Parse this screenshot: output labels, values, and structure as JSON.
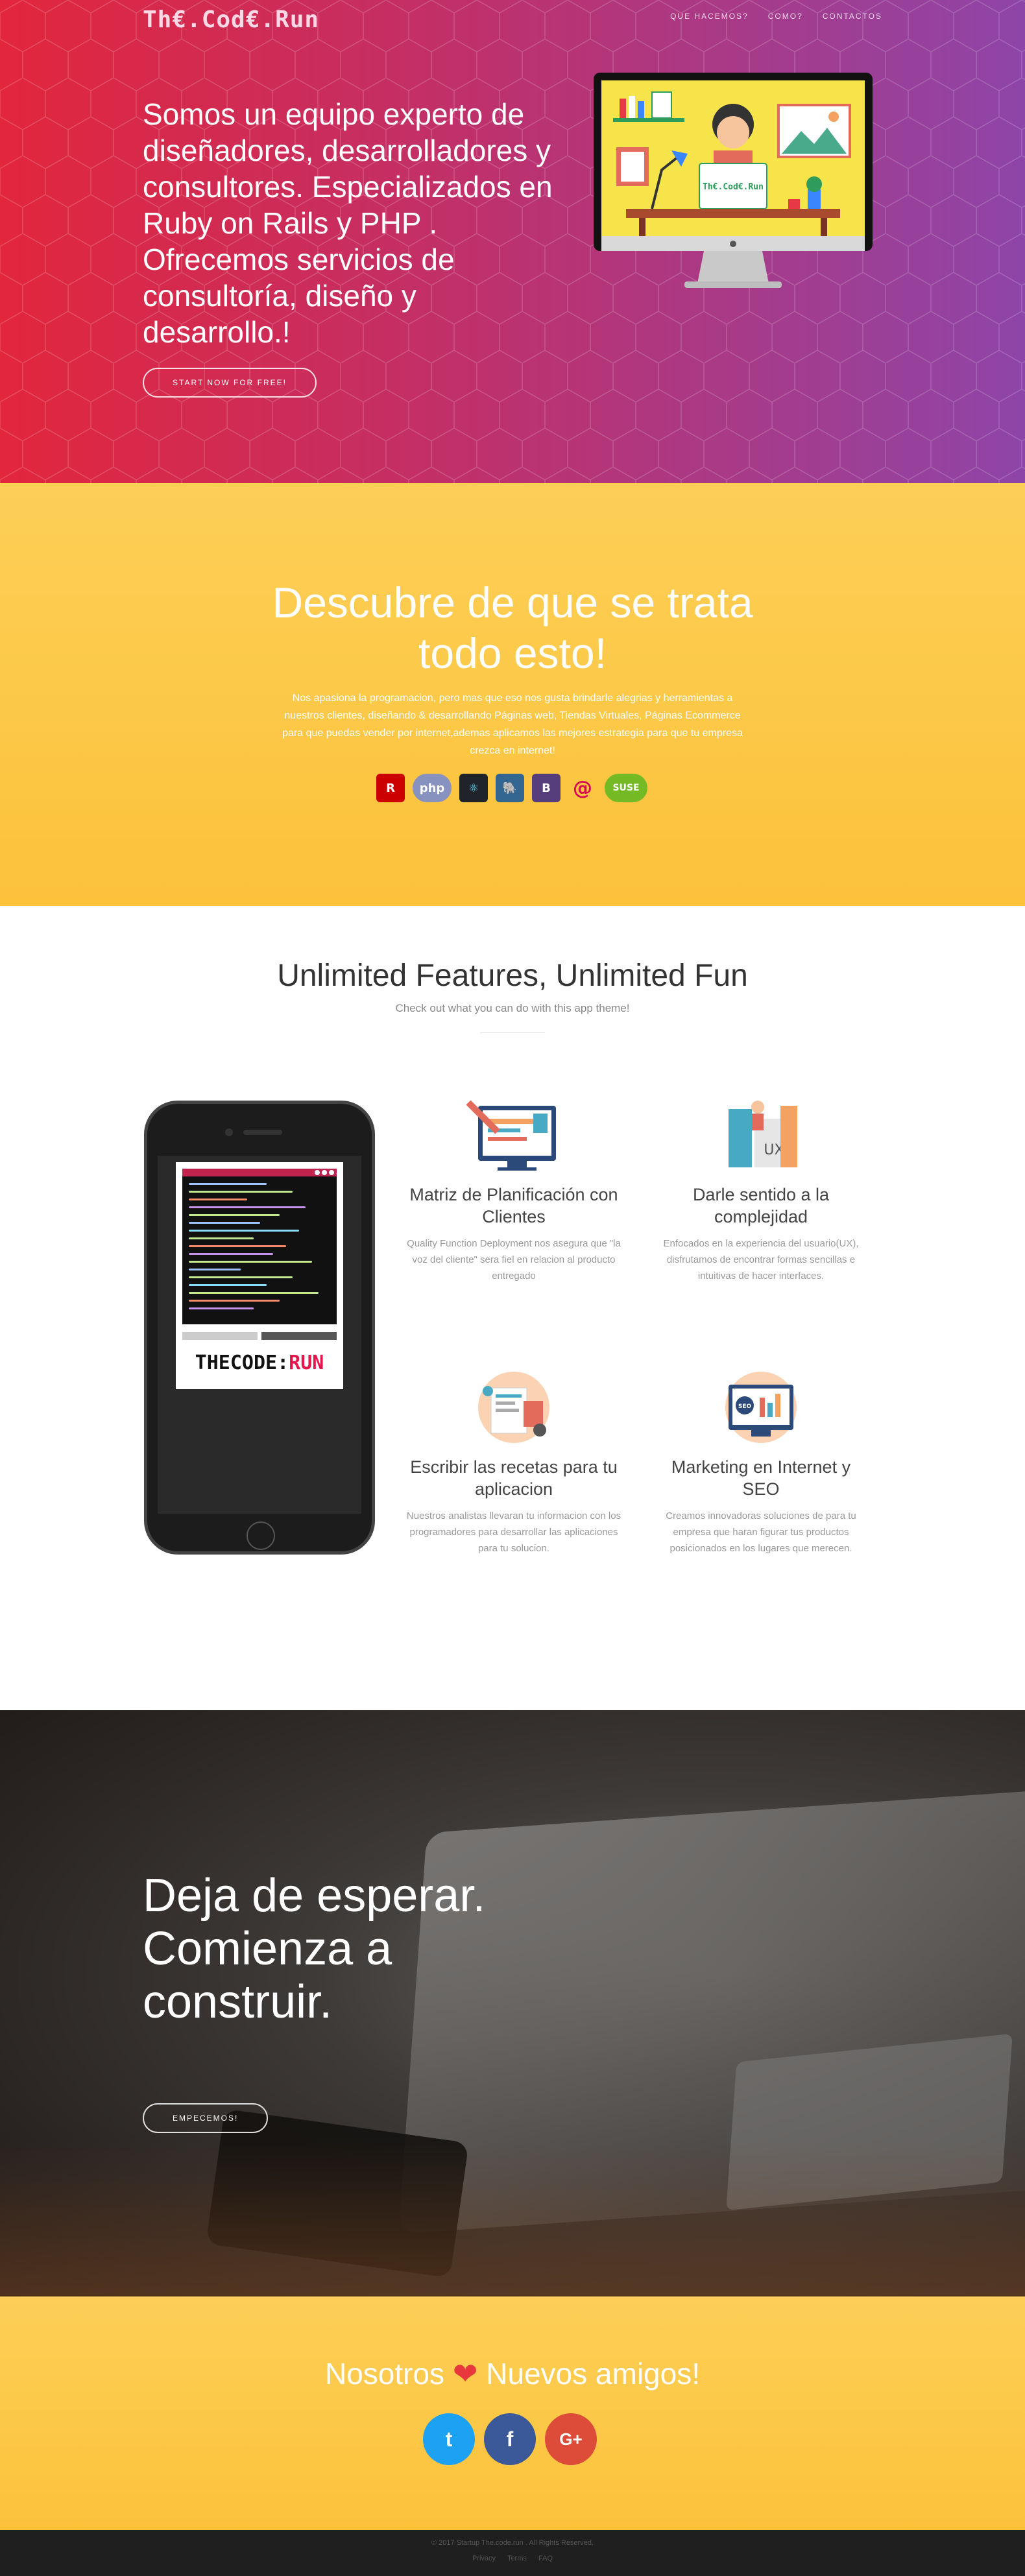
{
  "nav": {
    "brand": "Th€.Cod€.Run",
    "links": [
      "QUE HACEMOS?",
      "COMO?",
      "CONTACTOS"
    ]
  },
  "hero": {
    "headline": "Somos un equipo experto de diseñadores, desarrolladores y consultores. Especializados en Ruby on Rails y PHP . Ofrecemos servicios de consultoría, diseño y desarrollo.!",
    "cta": "Start Now for Free!",
    "monitor_screen_label": "Th€.Cod€.Run"
  },
  "discover": {
    "title": "Descubre de que se trata todo esto!",
    "text": "Nos apasiona la programacion, pero mas que eso nos gusta brindarle alegrias y herramientas a nuestros clientes, diseñando & desarrollando Páginas web, Tiendas Virtuales, Páginas Ecommerce para que puedas vender por internet,ademas aplicamos las mejores estrategia para que tu empresa crezca en internet!",
    "tech_icons": [
      "rails-icon",
      "php-icon",
      "react-icon",
      "postgresql-icon",
      "bootstrap-icon",
      "debian-icon",
      "opensuse-icon"
    ]
  },
  "features": {
    "title": "Unlimited Features, Unlimited Fun",
    "subtitle": "Check out what you can do with this app theme!",
    "phone_logo_a": "THECODE",
    "phone_logo_b": "RUN",
    "items": [
      {
        "title": "Matriz de Planificación con Clientes",
        "desc": "Quality Function Deployment nos asegura que \"la voz del cliente\" sera fiel en relacion al producto entregado",
        "icon": "planning-icon"
      },
      {
        "title": "Darle sentido a la complejidad",
        "desc": "Enfocados en la experiencia del usuario(UX), disfrutamos de encontrar formas sencillas e intuitivas de hacer interfaces.",
        "icon": "ux-icon",
        "icon_label": "UX"
      },
      {
        "title": "Escribir las recetas para tu aplicacion",
        "desc": "Nuestros analistas llevaran tu informacion con los programadores para desarrollar las aplicaciones para tu solucion.",
        "icon": "recipe-icon"
      },
      {
        "title": "Marketing en Internet y SEO",
        "desc": "Creamos innovadoras soluciones de para tu empresa que haran figurar tus productos posicionados en los lugares que merecen.",
        "icon": "seo-icon",
        "icon_label": "SEO"
      }
    ]
  },
  "cta": {
    "title": "Deja de esperar. Comienza a construir.",
    "button": "Empecemos!"
  },
  "social": {
    "left": "Nosotros",
    "right": "Nuevos amigos!",
    "buttons": [
      {
        "name": "twitter",
        "glyph": "t",
        "color": "#1da1f2"
      },
      {
        "name": "facebook",
        "glyph": "f",
        "color": "#3b5998"
      },
      {
        "name": "google-plus",
        "glyph": "G+",
        "color": "#dd4b39"
      }
    ]
  },
  "footer": {
    "copyright": "© 2017 Startup The.code.run . All Rights Reserved.",
    "links": [
      "Privacy",
      "Terms",
      "FAQ"
    ]
  },
  "colors": {
    "hero_start": "#e2263c",
    "hero_end": "#8e45a8",
    "yellow": "#fcc23a",
    "brand_pink": "#e4174d"
  }
}
